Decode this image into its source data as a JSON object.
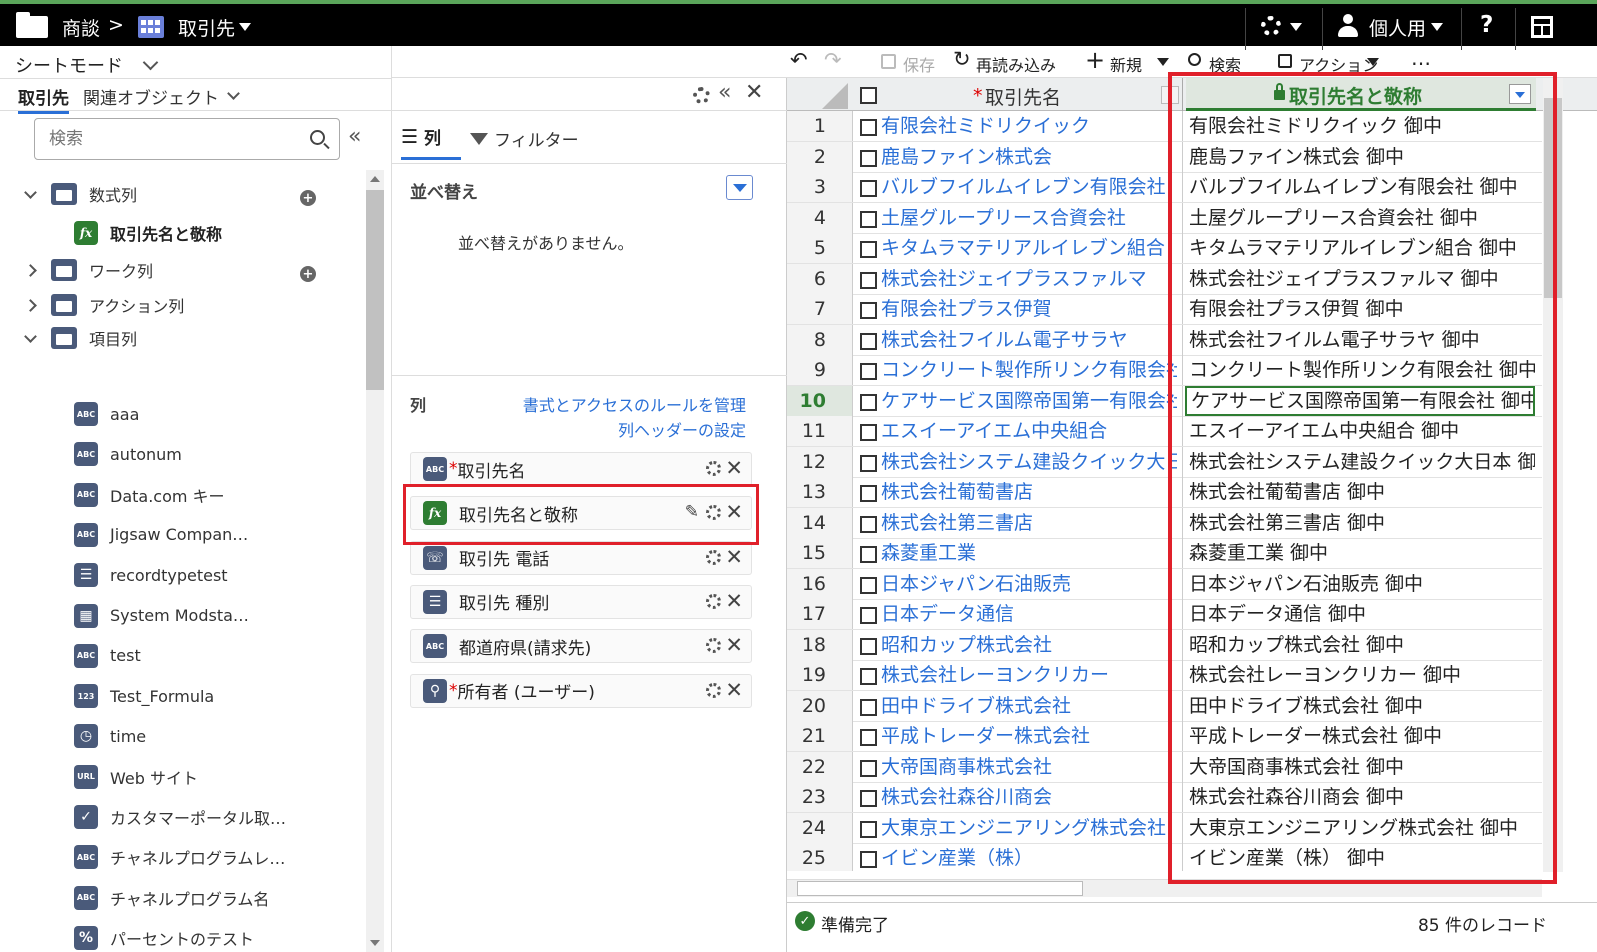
{
  "topbar": {
    "breadcrumb_1": "商談",
    "breadcrumb_sep": ">",
    "breadcrumb_2": "取引先",
    "user": "個人用",
    "help": "?"
  },
  "left_panel": {
    "mode": "シートモード",
    "tabs": [
      "取引先",
      "関連オブジェクト"
    ],
    "search_placeholder": "検索",
    "tree": [
      {
        "label": "数式列",
        "type": "folder",
        "expanded": true
      },
      {
        "label": "取引先名と敬称",
        "type": "fx",
        "child": true
      },
      {
        "label": "ワーク列",
        "type": "folder",
        "expanded": false
      },
      {
        "label": "アクション列",
        "type": "folder",
        "expanded": false
      },
      {
        "label": "項目列",
        "type": "folder",
        "expanded": true
      }
    ],
    "fields": [
      {
        "label": "aaa",
        "icon": "ABC"
      },
      {
        "label": "autonum",
        "icon": "ABC"
      },
      {
        "label": "Data.com キー",
        "icon": "ABC"
      },
      {
        "label": "Jigsaw Compan…",
        "icon": "ABC"
      },
      {
        "label": "recordtypetest",
        "icon": "list"
      },
      {
        "label": "System Modsta…",
        "icon": "cal"
      },
      {
        "label": "test",
        "icon": "ABC"
      },
      {
        "label": "Test_Formula",
        "icon": "123"
      },
      {
        "label": "time",
        "icon": "clock"
      },
      {
        "label": "Web サイト",
        "icon": "URL"
      },
      {
        "label": "カスタマーポータル取…",
        "icon": "check"
      },
      {
        "label": "チャネルプログラムレ…",
        "icon": "ABC"
      },
      {
        "label": "チャネルプログラム名",
        "icon": "ABC"
      },
      {
        "label": "パーセントのテスト",
        "icon": "%"
      }
    ]
  },
  "mid_panel": {
    "tab_columns": "列",
    "tab_filter": "フィルター",
    "sort_title": "並べ替え",
    "sort_empty": "並べ替えがありません。",
    "columns_title": "列",
    "link_rules": "書式とアクセスのルールを管理",
    "link_header": "列ヘッダーの設定",
    "columns": [
      {
        "label": "取引先名",
        "required": true,
        "icon": "ABC"
      },
      {
        "label": "取引先名と敬称",
        "required": false,
        "icon": "fx",
        "highlight": true
      },
      {
        "label": "取引先 電話",
        "required": false,
        "icon": "phone"
      },
      {
        "label": "取引先 種別",
        "required": false,
        "icon": "list"
      },
      {
        "label": "都道府県(請求先)",
        "required": false,
        "icon": "ABC"
      },
      {
        "label": "所有者 (ユーザー)",
        "required": true,
        "icon": "key"
      }
    ]
  },
  "toolbar": {
    "save": "保存",
    "reload": "再読み込み",
    "new": "新規",
    "search": "検索",
    "action": "アクション",
    "more": "…"
  },
  "grid": {
    "col1_header": "取引先名",
    "col2_header": "取引先名と敬称",
    "selected_row": 10,
    "rows": [
      {
        "n": "1",
        "name": "有限会社ミドリクイック",
        "honor": "有限会社ミドリクイック 御中"
      },
      {
        "n": "2",
        "name": "鹿島ファイン株式会",
        "honor": "鹿島ファイン株式会 御中"
      },
      {
        "n": "3",
        "name": "バルブフイルムイレブン有限会社",
        "honor": "バルブフイルムイレブン有限会社 御中"
      },
      {
        "n": "4",
        "name": "土屋グループリース合資会社",
        "honor": "土屋グループリース合資会社 御中"
      },
      {
        "n": "5",
        "name": "キタムラマテリアルイレブン組合",
        "honor": "キタムラマテリアルイレブン組合 御中"
      },
      {
        "n": "6",
        "name": "株式会社ジェイプラスファルマ",
        "honor": "株式会社ジェイプラスファルマ 御中"
      },
      {
        "n": "7",
        "name": "有限会社プラス伊賀",
        "honor": "有限会社プラス伊賀 御中"
      },
      {
        "n": "8",
        "name": "株式会社フイルム電子サラヤ",
        "honor": "株式会社フイルム電子サラヤ 御中"
      },
      {
        "n": "9",
        "name": "コンクリート製作所リンク有限会社",
        "honor": "コンクリート製作所リンク有限会社 御中"
      },
      {
        "n": "10",
        "name": "ケアサービス国際帝国第一有限会社",
        "honor": "ケアサービス国際帝国第一有限会社 御中"
      },
      {
        "n": "11",
        "name": "エスイーアイエム中央組合",
        "honor": "エスイーアイエム中央組合 御中"
      },
      {
        "n": "12",
        "name": "株式会社システム建設クイック大日本",
        "honor": "株式会社システム建設クイック大日本 御中"
      },
      {
        "n": "13",
        "name": "株式会社葡萄書店",
        "honor": "株式会社葡萄書店 御中"
      },
      {
        "n": "14",
        "name": "株式会社第三書店",
        "honor": "株式会社第三書店 御中"
      },
      {
        "n": "15",
        "name": "森菱重工業",
        "honor": "森菱重工業 御中"
      },
      {
        "n": "16",
        "name": "日本ジャパン石油販売",
        "honor": "日本ジャパン石油販売 御中"
      },
      {
        "n": "17",
        "name": "日本データ通信",
        "honor": "日本データ通信 御中"
      },
      {
        "n": "18",
        "name": "昭和カップ株式会社",
        "honor": "昭和カップ株式会社 御中"
      },
      {
        "n": "19",
        "name": "株式会社レーヨンクリカー",
        "honor": "株式会社レーヨンクリカー 御中"
      },
      {
        "n": "20",
        "name": "田中ドライブ株式会社",
        "honor": "田中ドライブ株式会社 御中"
      },
      {
        "n": "21",
        "name": "平成トレーダー株式会社",
        "honor": "平成トレーダー株式会社 御中"
      },
      {
        "n": "22",
        "name": "大帝国商事株式会社",
        "honor": "大帝国商事株式会社 御中"
      },
      {
        "n": "23",
        "name": "株式会社森谷川商会",
        "honor": "株式会社森谷川商会 御中"
      },
      {
        "n": "24",
        "name": "大東京エンジニアリング株式会社",
        "honor": "大東京エンジニアリング株式会社 御中"
      },
      {
        "n": "25",
        "name": "イビン産業（株）",
        "honor": "イビン産業（株） 御中"
      }
    ]
  },
  "status": {
    "ready": "準備完了",
    "count": "85 件のレコード"
  },
  "colors": {
    "accent_red": "#e0202a",
    "link": "#2a6fd6",
    "formula_green": "#2e7d32",
    "selected_border": "#2e7d32"
  }
}
